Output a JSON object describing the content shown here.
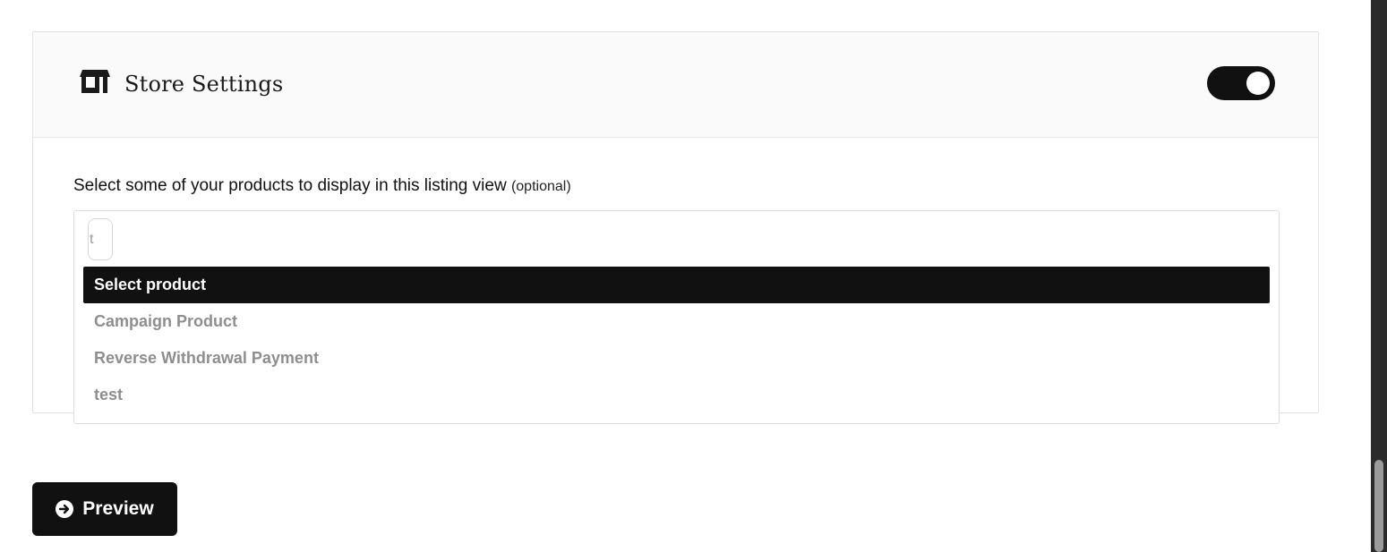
{
  "store_settings": {
    "title": "Store Settings",
    "icon": "store-icon",
    "toggle_on": true
  },
  "products_field": {
    "label": "Select some of your products to display in this listing view",
    "optional_note": "(optional)",
    "search_value": "t",
    "options": [
      {
        "label": "Select product",
        "selected": true
      },
      {
        "label": "Campaign Product",
        "selected": false
      },
      {
        "label": "Reverse Withdrawal Payment",
        "selected": false
      },
      {
        "label": "test",
        "selected": false
      }
    ]
  },
  "preview_button": {
    "label": "Preview",
    "icon": "arrow-circle-right-icon"
  },
  "colors": {
    "accent": "#111111",
    "header_bg": "#fafafa",
    "muted_text": "#8e8e8e"
  }
}
